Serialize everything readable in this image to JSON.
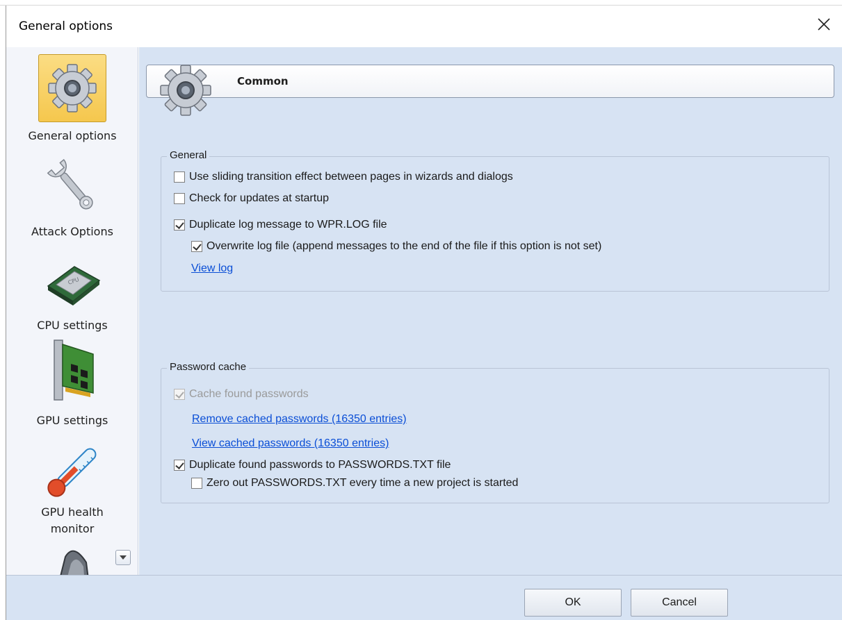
{
  "dialog": {
    "title": "General options"
  },
  "sidebar": {
    "items": [
      {
        "label": "General options",
        "icon": "gear-icon",
        "selected": true
      },
      {
        "label": "Attack Options",
        "icon": "wrench-icon",
        "selected": false
      },
      {
        "label": "CPU settings",
        "icon": "cpu-chip-icon",
        "selected": false
      },
      {
        "label": "GPU settings",
        "icon": "gpu-card-icon",
        "selected": false
      },
      {
        "label": "GPU health monitor",
        "label_line1": "GPU health",
        "label_line2": "monitor",
        "icon": "thermometer-icon",
        "selected": false
      }
    ],
    "partial_item_icon": "speaker-icon"
  },
  "header": {
    "title": "Common",
    "icon": "gear-icon"
  },
  "general_group": {
    "legend": "General",
    "options": [
      {
        "label": "Use sliding transition effect between pages in wizards and dialogs",
        "checked": false
      },
      {
        "label": "Check for updates at startup",
        "checked": false
      },
      {
        "label": "Duplicate log message to WPR.LOG file",
        "checked": true
      },
      {
        "label": "Overwrite log file (append messages to the end of the file if this option is not set)",
        "checked": true
      }
    ],
    "view_log_link": "View log"
  },
  "password_group": {
    "legend": "Password cache",
    "cache_found": {
      "label": "Cache found passwords",
      "checked": true,
      "disabled": true
    },
    "remove_link": "Remove cached passwords (16350 entries)",
    "view_link": "View cached passwords  (16350 entries)",
    "duplicate": {
      "label": "Duplicate found passwords to PASSWORDS.TXT file",
      "checked": true
    },
    "zero_out": {
      "label": "Zero out PASSWORDS.TXT every time a new project is started",
      "checked": false
    }
  },
  "footer": {
    "ok_label": "OK",
    "cancel_label": "Cancel"
  },
  "colors": {
    "content_bg": "#d7e3f3",
    "selected_bg": "#f5c74d",
    "link": "#0a4ed6"
  }
}
